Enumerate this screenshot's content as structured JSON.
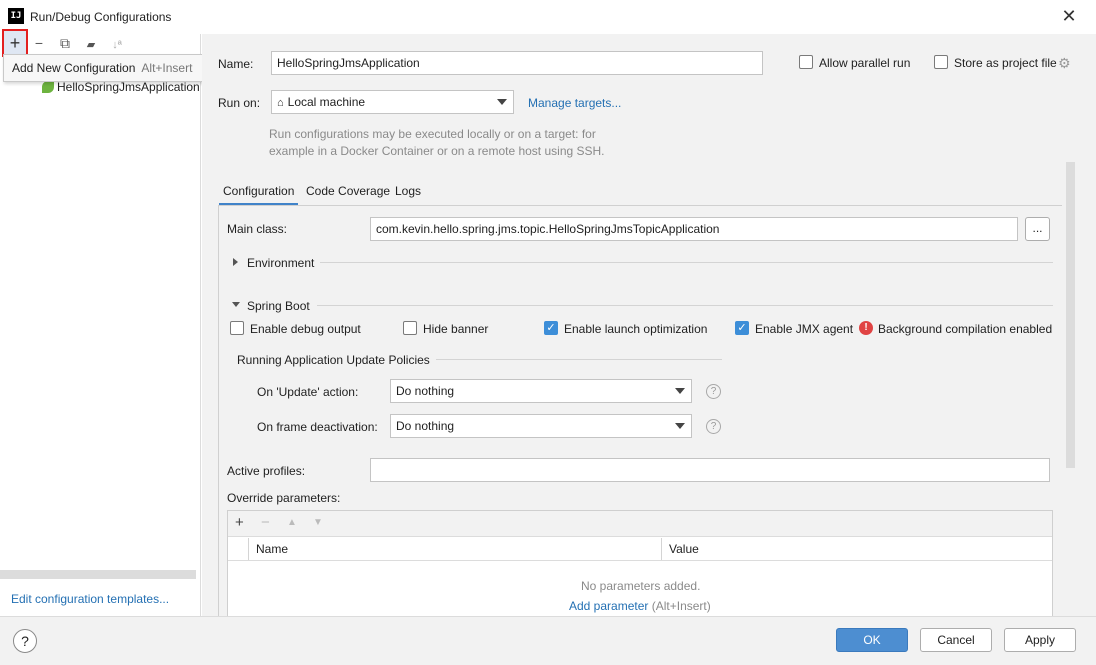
{
  "window": {
    "app_icon_text": "IJ",
    "title": "Run/Debug Configurations",
    "close_glyph": "✕"
  },
  "left_toolbar": {
    "add_glyph": "+",
    "remove_glyph": "−",
    "copy_glyph": "⧉",
    "folder_glyph": "▰",
    "sort_glyph": "↓ª",
    "tooltip_label": "Add New Configuration",
    "tooltip_shortcut": "Alt+Insert"
  },
  "tree": {
    "item_label": "HelloSpringJmsApplication"
  },
  "edit_templates_link": "Edit configuration templates...",
  "form": {
    "name_label": "Name:",
    "name_value": "HelloSpringJmsApplication",
    "allow_parallel_label": "Allow parallel run",
    "store_project_label": "Store as project file",
    "run_on_label": "Run on:",
    "run_on_value": "Local machine",
    "manage_targets_link": "Manage targets...",
    "run_on_hint_line1": "Run configurations may be executed locally or on a target: for",
    "run_on_hint_line2": "example in a Docker Container or on a remote host using SSH."
  },
  "tabs": [
    {
      "label": "Configuration",
      "active": true
    },
    {
      "label": "Code Coverage",
      "active": false
    },
    {
      "label": "Logs",
      "active": false
    }
  ],
  "configuration": {
    "main_class_label": "Main class:",
    "main_class_value": "com.kevin.hello.spring.jms.topic.HelloSpringJmsTopicApplication",
    "browse_label": "...",
    "environment_label": "Environment",
    "spring_boot_label": "Spring Boot",
    "enable_debug_label": "Enable debug output",
    "enable_debug_checked": false,
    "hide_banner_label": "Hide banner",
    "hide_banner_checked": false,
    "launch_opt_label": "Enable launch optimization",
    "launch_opt_checked": true,
    "jmx_label": "Enable JMX agent",
    "jmx_checked": true,
    "bg_compilation_label": "Background compilation enabled",
    "policies_label": "Running Application Update Policies",
    "update_action_label": "On 'Update' action:",
    "update_action_value": "Do nothing",
    "frame_deactivation_label": "On frame deactivation:",
    "frame_deactivation_value": "Do nothing",
    "help_glyph": "?",
    "active_profiles_label": "Active profiles:",
    "active_profiles_value": "",
    "override_params_label": "Override parameters:",
    "params_add_glyph": "+",
    "params_remove_glyph": "−",
    "params_up_glyph": "▲",
    "params_down_glyph": "▼",
    "col_name": "Name",
    "col_value": "Value",
    "empty_text": "No parameters added.",
    "add_param_link": "Add parameter",
    "add_param_shortcut": "(Alt+Insert)"
  },
  "footer": {
    "help_glyph": "?",
    "ok_label": "OK",
    "cancel_label": "Cancel",
    "apply_label": "Apply"
  },
  "colors": {
    "accent": "#4d8ed1",
    "link": "#2470b3",
    "highlight_border": "#e32020",
    "error_icon": "#e04343",
    "spring_leaf": "#6db33f"
  }
}
